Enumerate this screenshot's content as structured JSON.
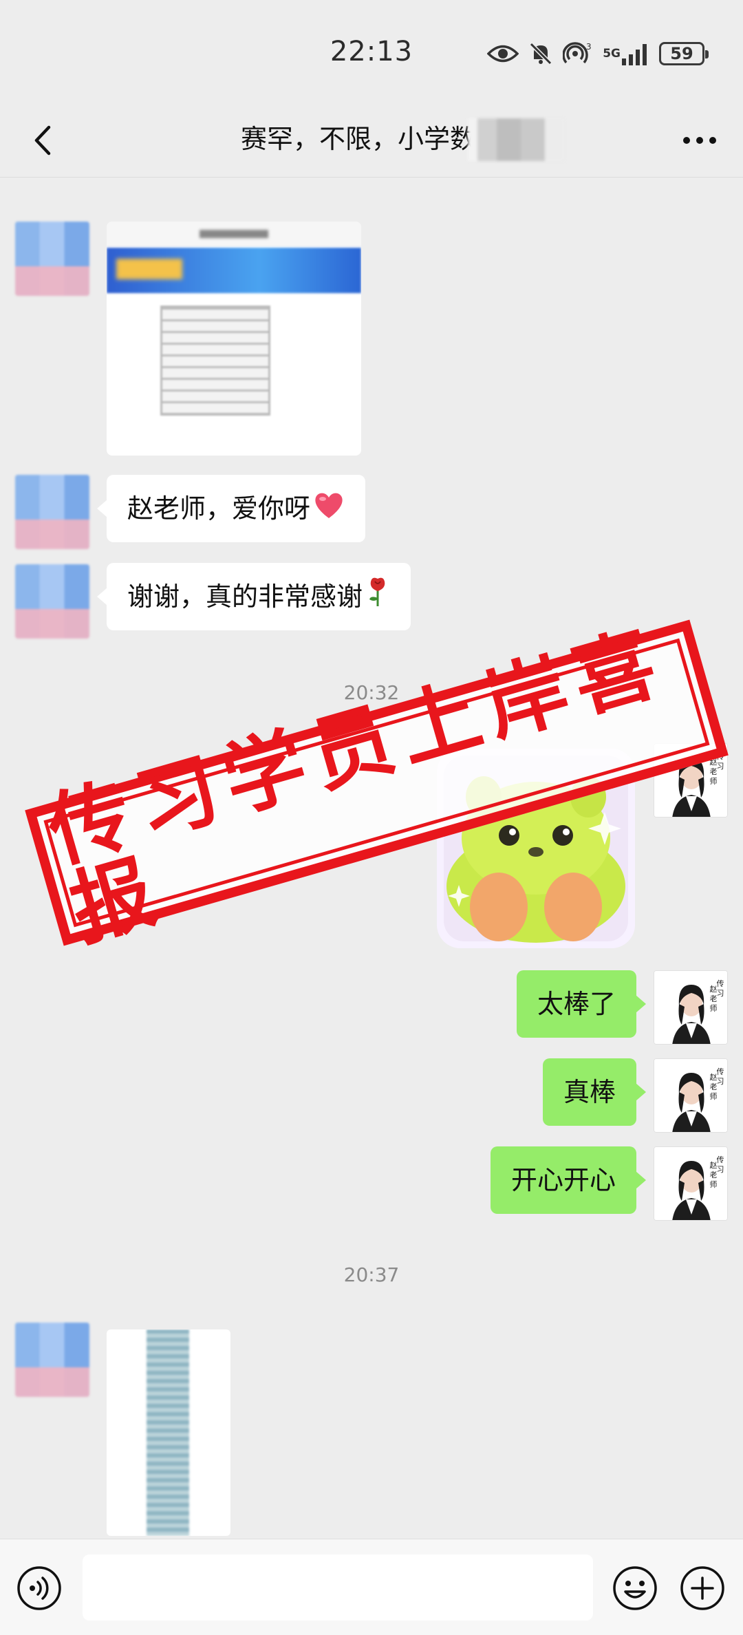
{
  "status_bar": {
    "time": "22:13",
    "battery": "59",
    "network_label": "5G",
    "icons": [
      "eye-icon",
      "bell-muted-icon",
      "hotspot-icon",
      "signal-icon",
      "battery-icon"
    ]
  },
  "header": {
    "title": "赛罕，不限，小学数学",
    "back_icon": "chevron-left-icon",
    "more_icon": "more-dots-icon"
  },
  "messages": [
    {
      "side": "left",
      "type": "image",
      "content": "blurred-document-image"
    },
    {
      "side": "left",
      "type": "text",
      "text": "赵老师，爱你呀",
      "emoji": "heart"
    },
    {
      "side": "left",
      "type": "text",
      "text": "谢谢，真的非常感谢",
      "emoji": "rose"
    },
    {
      "type": "timestamp",
      "text": "20:32"
    },
    {
      "side": "right",
      "type": "sticker",
      "content": "green-bear-sticker"
    },
    {
      "side": "right",
      "type": "text",
      "text": "太棒了"
    },
    {
      "side": "right",
      "type": "text",
      "text": "真棒"
    },
    {
      "side": "right",
      "type": "text",
      "text": "开心开心"
    },
    {
      "type": "timestamp",
      "text": "20:37"
    },
    {
      "side": "left",
      "type": "image",
      "content": "blurred-long-image"
    }
  ],
  "teacher_avatar_caption": "传习赵老师",
  "stamp": {
    "text": "传习学员上岸喜报",
    "color": "#e8161c"
  },
  "input_bar": {
    "voice_icon": "voice-icon",
    "emoji_icon": "emoji-icon",
    "plus_icon": "plus-icon",
    "placeholder": ""
  },
  "colors": {
    "background": "#ededed",
    "bubble_right": "#95ec69",
    "bubble_left": "#ffffff",
    "stamp": "#e8161c"
  }
}
